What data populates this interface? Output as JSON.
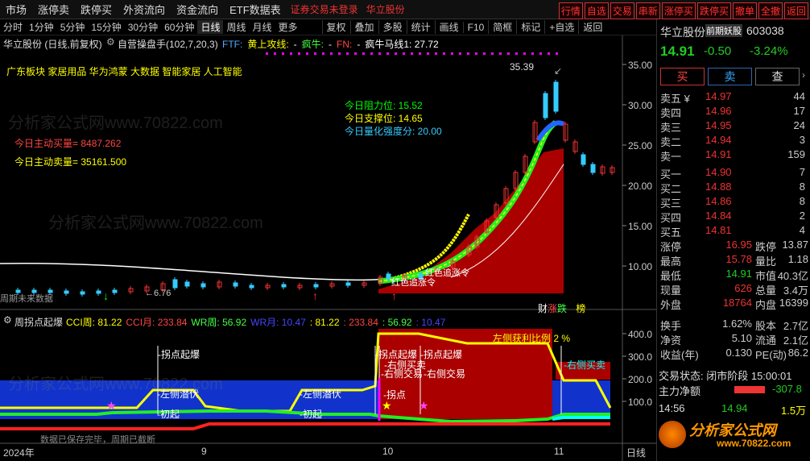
{
  "topbar": {
    "menus": [
      "市场",
      "涨停卖",
      "跌停买",
      "外资流向",
      "资金流向",
      "ETF数据表"
    ],
    "notice": "证券交易未登录",
    "stock_name": "华立股份",
    "buttons": [
      "行情",
      "自选",
      "交易",
      "串新",
      "涨停买",
      "跌停买",
      "撤单",
      "全撤",
      "返回"
    ]
  },
  "timeframes": [
    "分时",
    "1分钟",
    "5分钟",
    "15分钟",
    "30分钟",
    "60分钟",
    "日线",
    "周线",
    "月线",
    "更多"
  ],
  "active_timeframe": "日线",
  "tools": [
    "复权",
    "叠加",
    "多股",
    "统计",
    "画线",
    "F10",
    "简框",
    "标记",
    "+自选",
    "返回"
  ],
  "main_chart": {
    "title": "华立股份 (日线,前复权)",
    "indicator": "自营操盘手(102,7,20,3)",
    "fields": [
      {
        "label": "FTF:",
        "color": "#5af"
      },
      {
        "label": "黄上攻线:",
        "color": "#ff0"
      },
      {
        "label": "-",
        "color": "#fff"
      },
      {
        "label": "疯牛:",
        "color": "#4f4"
      },
      {
        "label": "-",
        "color": "#fff"
      },
      {
        "label": "FN:",
        "color": "#f44"
      },
      {
        "label": "-",
        "color": "#fff"
      },
      {
        "label": "疯牛马线1: 27.72",
        "color": "#fff"
      }
    ],
    "concepts": "广东板块 家居用品 华为鸿蒙 大数据 智能家居 人工智能",
    "resistance": "今日阻力位: 15.52",
    "support": "今日支撑位: 14.65",
    "strength": "今日量化强度分: 20.00",
    "active_buy": "今日主动买量= 8487.262",
    "active_sell": "今日主动卖量= 35161.500",
    "high_mark": "35.39",
    "low_mark": "6.76",
    "chase1": "红色追涨令",
    "chase2": "红色追涨令",
    "yaxis": [
      "35.00",
      "30.00",
      "25.00",
      "20.00",
      "15.00",
      "10.00"
    ],
    "bottom_left": "周期未来数据",
    "tags": [
      "财",
      "涨",
      "跌",
      "榜"
    ]
  },
  "sub_chart": {
    "title": "周拐点起爆",
    "fields": [
      {
        "label": "CCI周: 81.22",
        "color": "#ff0"
      },
      {
        "label": "CCI月: 233.84",
        "color": "#f44"
      },
      {
        "label": "WR周: 56.92",
        "color": "#4f4"
      },
      {
        "label": "WR月: 10.47",
        "color": "#44f"
      },
      {
        "label": ": 81.22",
        "color": "#ff0"
      },
      {
        "label": ": 233.84",
        "color": "#f44"
      },
      {
        "label": ": 56.92",
        "color": "#4f4"
      },
      {
        "label": ": 10.47",
        "color": "#44f"
      }
    ],
    "yaxis": [
      "400.0",
      "300.0",
      "200.0",
      "100.0"
    ],
    "notes": [
      "拐点起爆",
      "拐点起爆",
      "拐点起爆",
      "左侧潜伏",
      "左侧潜伏",
      "初起",
      "初起",
      "右侧买卖",
      "右侧交易",
      "右侧交易",
      "拐点",
      "左侧获利比例 2 %",
      "右侧买卖"
    ],
    "bottom_text": "数据已保存完毕，周期已截断"
  },
  "xaxis": [
    "2024年",
    "9",
    "10",
    "11",
    "日线"
  ],
  "quote": {
    "name": "华立股份",
    "badge": "前期妖股",
    "code": "603038",
    "price": "14.91",
    "change": "-0.50",
    "change_pct": "-3.24%",
    "buy_label": "买",
    "sell_label": "卖",
    "search_label": "查",
    "asks": [
      {
        "n": "卖五 ¥",
        "p": "14.97",
        "v": "44"
      },
      {
        "n": "卖四",
        "p": "14.96",
        "v": "17"
      },
      {
        "n": "卖三",
        "p": "14.95",
        "v": "24"
      },
      {
        "n": "卖二",
        "p": "14.94",
        "v": "3"
      },
      {
        "n": "卖一",
        "p": "14.91",
        "v": "159"
      }
    ],
    "bids": [
      {
        "n": "买一",
        "p": "14.90",
        "v": "7"
      },
      {
        "n": "买二",
        "p": "14.88",
        "v": "8"
      },
      {
        "n": "买三",
        "p": "14.86",
        "v": "8"
      },
      {
        "n": "买四",
        "p": "14.84",
        "v": "2"
      },
      {
        "n": "买五",
        "p": "14.81",
        "v": "4"
      }
    ],
    "stats": [
      {
        "a": "涨停",
        "av": "16.95",
        "b": "跌停",
        "bv": "13.87"
      },
      {
        "a": "最高",
        "av": "15.78",
        "b": "量比",
        "bv": "1.18"
      },
      {
        "a": "最低",
        "av": "14.91",
        "b": "市值",
        "bv": "40.3亿"
      },
      {
        "a": "现量",
        "av": "626",
        "b": "总量",
        "bv": "3.4万"
      },
      {
        "a": "外盘",
        "av": "18764",
        "b": "内盘",
        "bv": "16399"
      }
    ],
    "stats2": [
      {
        "a": "换手",
        "av": "1.62%",
        "b": "股本",
        "bv": "2.7亿"
      },
      {
        "a": "净资",
        "av": "5.10",
        "b": "流通",
        "bv": "2.1亿"
      },
      {
        "a": "收益(年)",
        "av": "0.130",
        "b": "PE(动)",
        "bv": "86.2"
      }
    ],
    "status": "交易状态: 闭市阶段 15:00:01",
    "net_flow": "主力净额",
    "net_flow_val": "-307.8",
    "tick_time": "14:56",
    "tick_price": "14.94",
    "tick_vol": "1.5万",
    "logo": "分析家公式网",
    "logo_url": "www.70822.com"
  },
  "watermark": "分析家公式网www.70822.com"
}
